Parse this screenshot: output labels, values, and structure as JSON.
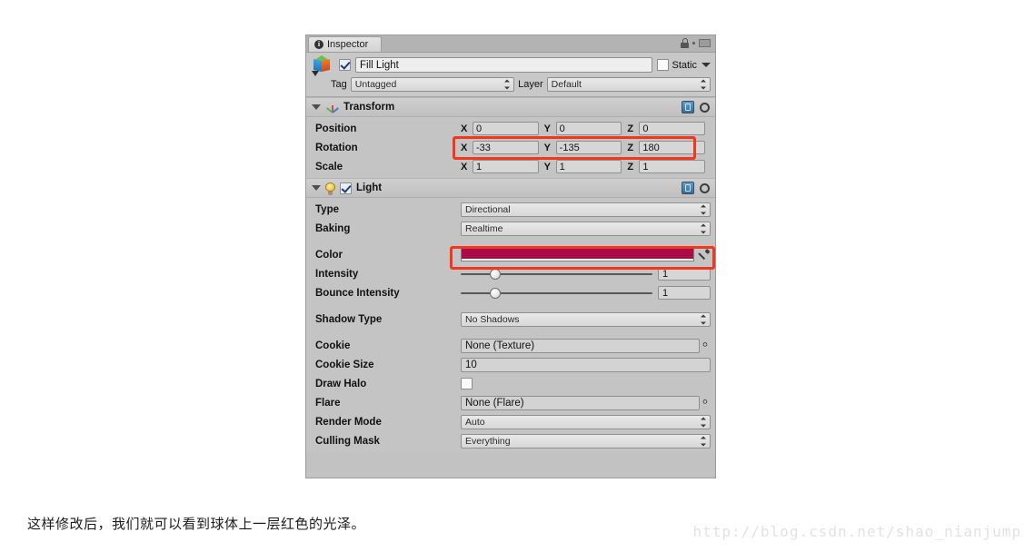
{
  "window": {
    "tab_label": "Inspector",
    "tab_icon": "info-circle-icon",
    "lock_icon": "lock-icon",
    "menu_icon": "hamburger-menu-icon"
  },
  "object_header": {
    "object_icon": "gameobject-cube-icon",
    "enabled": true,
    "name": "Fill Light",
    "static_label": "Static",
    "static_checked": false,
    "tag_label": "Tag",
    "tag_value": "Untagged",
    "layer_label": "Layer",
    "layer_value": "Default"
  },
  "transform": {
    "title": "Transform",
    "icon": "transform-axis-icon",
    "help_icon": "help-book-icon",
    "gear_icon": "settings-gear-icon",
    "rows": [
      {
        "label": "Position",
        "x": "0",
        "y": "0",
        "z": "0"
      },
      {
        "label": "Rotation",
        "x": "-33",
        "y": "-135",
        "z": "180"
      },
      {
        "label": "Scale",
        "x": "1",
        "y": "1",
        "z": "1"
      }
    ],
    "axis_labels": {
      "x": "X",
      "y": "Y",
      "z": "Z"
    }
  },
  "light": {
    "title": "Light",
    "icon": "light-bulb-icon",
    "enabled": true,
    "help_icon": "help-book-icon",
    "gear_icon": "settings-gear-icon",
    "type_label": "Type",
    "type_value": "Directional",
    "baking_label": "Baking",
    "baking_value": "Realtime",
    "color_label": "Color",
    "color_value": "#ad0b47",
    "eyedropper_icon": "eyedropper-icon",
    "intensity_label": "Intensity",
    "intensity_value": "1",
    "intensity_pct": 15,
    "bounce_label": "Bounce Intensity",
    "bounce_value": "1",
    "bounce_pct": 15,
    "shadow_label": "Shadow Type",
    "shadow_value": "No Shadows",
    "cookie_label": "Cookie",
    "cookie_value": "None (Texture)",
    "cookie_size_label": "Cookie Size",
    "cookie_size_value": "10",
    "draw_halo_label": "Draw Halo",
    "draw_halo_checked": false,
    "flare_label": "Flare",
    "flare_value": "None (Flare)",
    "render_mode_label": "Render Mode",
    "render_mode_value": "Auto",
    "culling_label": "Culling Mask",
    "culling_value": "Everything",
    "object_picker_icon": "object-picker-icon"
  },
  "annotations": {
    "highlight_color": "#f4361d",
    "rotation_highlight": "rotation-xyz-highlight",
    "color_highlight": "light-color-highlight"
  },
  "page": {
    "caption": "这样修改后，我们就可以看到球体上一层红色的光泽。",
    "watermark": "http://blog.csdn.net/shao_nianjump"
  }
}
